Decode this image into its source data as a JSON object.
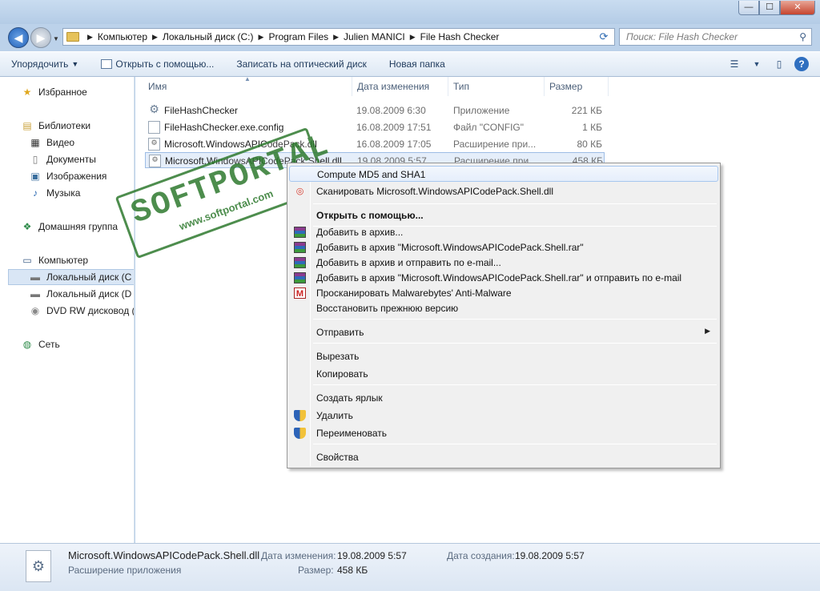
{
  "window": {
    "min": "—",
    "max": "☐",
    "close": "✕"
  },
  "nav": {
    "breadcrumbs": [
      "Компьютер",
      "Локальный диск (C:)",
      "Program Files",
      "Julien MANICI",
      "File Hash Checker"
    ],
    "search_placeholder": "Поиск: File Hash Checker"
  },
  "toolbar": {
    "organize": "Упорядочить",
    "open_with": "Открыть с помощью...",
    "burn": "Записать на оптический диск",
    "new_folder": "Новая папка"
  },
  "sidebar": {
    "favorites": "Избранное",
    "libraries": "Библиотеки",
    "video": "Видео",
    "documents": "Документы",
    "images": "Изображения",
    "music": "Музыка",
    "homegroup": "Домашняя группа",
    "computer": "Компьютер",
    "drive_c": "Локальный диск (C",
    "drive_d": "Локальный диск (D",
    "dvd": "DVD RW дисковод (",
    "network": "Сеть"
  },
  "columns": {
    "name": "Имя",
    "date": "Дата изменения",
    "type": "Тип",
    "size": "Размер"
  },
  "files": [
    {
      "name": "FileHashChecker",
      "date": "19.08.2009 6:30",
      "type": "Приложение",
      "size": "221 КБ"
    },
    {
      "name": "FileHashChecker.exe.config",
      "date": "16.08.2009 17:51",
      "type": "Файл \"CONFIG\"",
      "size": "1 КБ"
    },
    {
      "name": "Microsoft.WindowsAPICodePack.dll",
      "date": "16.08.2009 17:05",
      "type": "Расширение при...",
      "size": "80 КБ"
    },
    {
      "name": "Microsoft.WindowsAPICodePack.Shell.dll",
      "date": "19.08.2009 5:57",
      "type": "Расширение при...",
      "size": "458 КБ"
    }
  ],
  "watermark": {
    "main": "SOFTPORTAL",
    "sub": "www.softportal.com"
  },
  "context_menu": {
    "compute": "Compute MD5 and SHA1",
    "scan": "Сканировать Microsoft.WindowsAPICodePack.Shell.dll",
    "open_with": "Открыть с помощью...",
    "add_archive": "Добавить в архив...",
    "add_rar": "Добавить в архив \"Microsoft.WindowsAPICodePack.Shell.rar\"",
    "add_email": "Добавить в архив и отправить по e-mail...",
    "add_rar_email": "Добавить в архив \"Microsoft.WindowsAPICodePack.Shell.rar\" и отправить по e-mail",
    "malwarebytes": "Просканировать Malwarebytes' Anti-Malware",
    "restore": "Восстановить прежнюю версию",
    "send_to": "Отправить",
    "cut": "Вырезать",
    "copy": "Копировать",
    "shortcut": "Создать ярлык",
    "delete": "Удалить",
    "rename": "Переименовать",
    "properties": "Свойства"
  },
  "details": {
    "filename": "Microsoft.WindowsAPICodePack.Shell.dll",
    "filetype": "Расширение приложения",
    "modified_label": "Дата изменения:",
    "modified_value": "19.08.2009 5:57",
    "created_label": "Дата создания:",
    "created_value": "19.08.2009 5:57",
    "size_label": "Размер:",
    "size_value": "458 КБ"
  }
}
